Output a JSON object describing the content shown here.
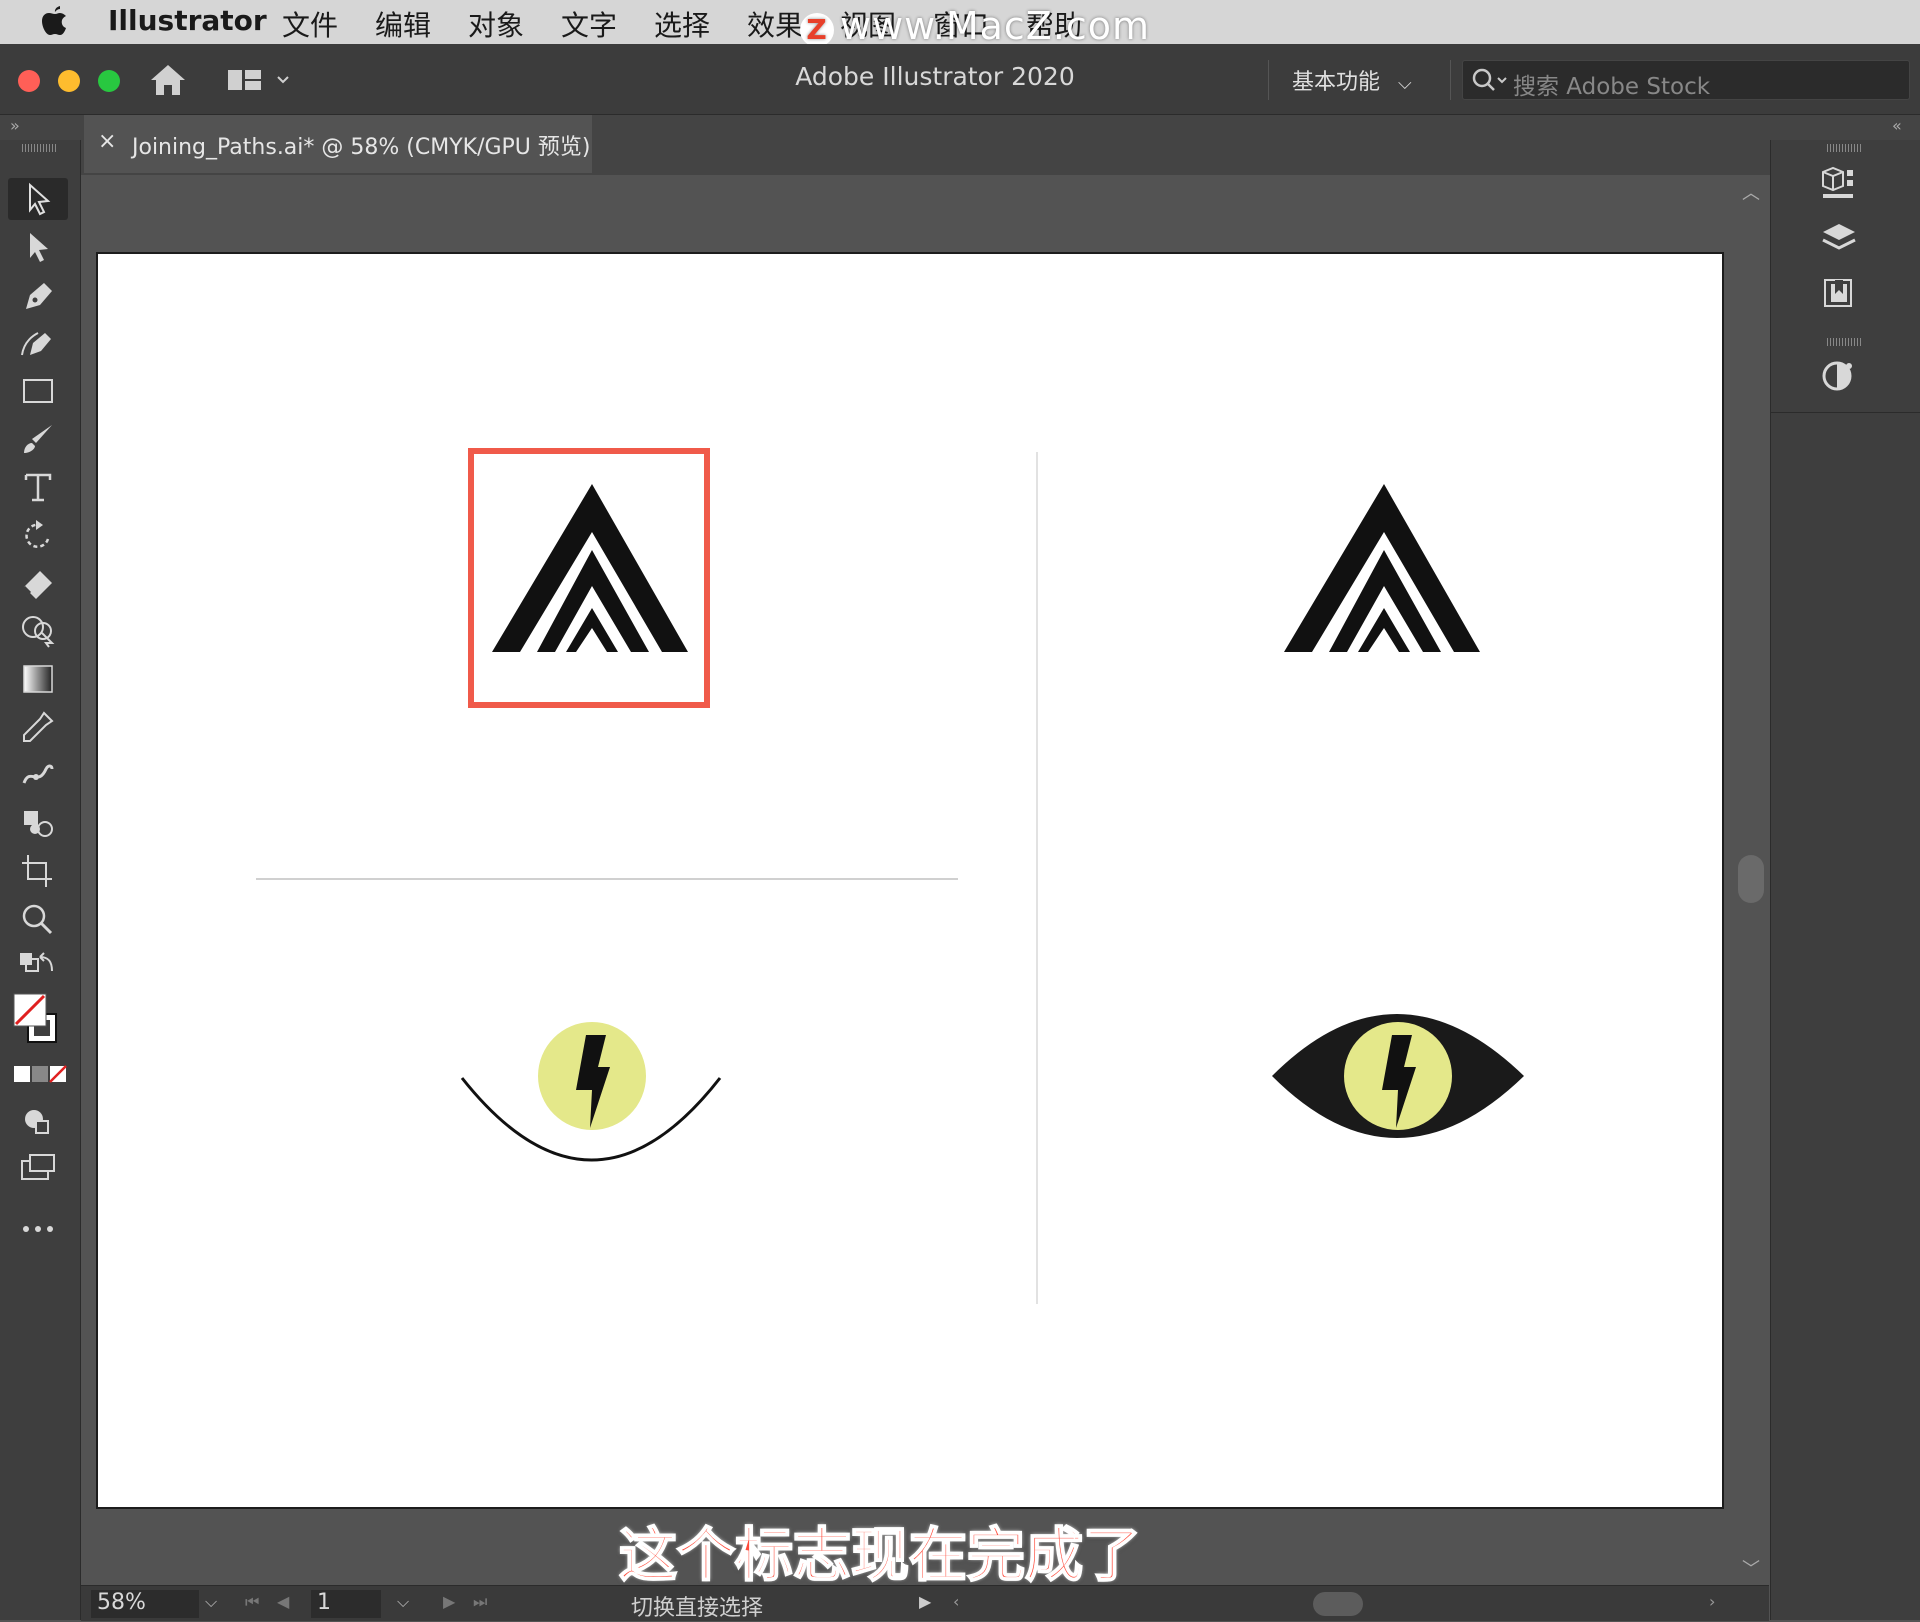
{
  "menubar": {
    "app_name": "Illustrator",
    "items": [
      "文件",
      "编辑",
      "对象",
      "文字",
      "选择",
      "效果",
      "视图",
      "窗口",
      "帮助"
    ]
  },
  "watermark": {
    "text": "www.MacZ.com",
    "badge": "Z"
  },
  "appbar": {
    "title": "Adobe Illustrator 2020",
    "workspace": "基本功能",
    "search_placeholder": "搜索 Adobe Stock"
  },
  "document_tab": {
    "close": "×",
    "title": "Joining_Paths.ai* @ 58% (CMYK/GPU 预览)"
  },
  "tools": [
    "selection-tool",
    "direct-selection-tool",
    "pen-tool",
    "curvature-tool",
    "rectangle-tool",
    "paintbrush-tool",
    "type-tool",
    "rotate-tool",
    "eraser-tool",
    "shape-builder-tool",
    "gradient-tool",
    "eyedropper-tool",
    "puppet-warp-tool",
    "symbol-sprayer-tool",
    "artboard-tool",
    "zoom-tool",
    "swap-fill-stroke",
    "fill-stroke-swatch",
    "color-mode-buttons",
    "draw-mode",
    "screen-mode",
    "edit-toolbar"
  ],
  "right_panels": [
    "libraries-icon",
    "layers-icon",
    "artboards-icon",
    "properties-icon"
  ],
  "artwork": {
    "highlight_color": "#f05a4a",
    "iris_color": "#e4e88a",
    "ink_color": "#111111",
    "eye_color": "#1a1a1a"
  },
  "subtitle": "这个标志现在完成了",
  "statusbar": {
    "zoom": "58%",
    "page": "1",
    "status_text": "切换直接选择"
  },
  "colors": {
    "chrome_dark": "#3e3e3e",
    "canvas_bg": "#535353",
    "menubar_bg": "#d6d6d6",
    "traffic_red": "#ff5f57",
    "traffic_yellow": "#febc2e",
    "traffic_green": "#28c840"
  }
}
